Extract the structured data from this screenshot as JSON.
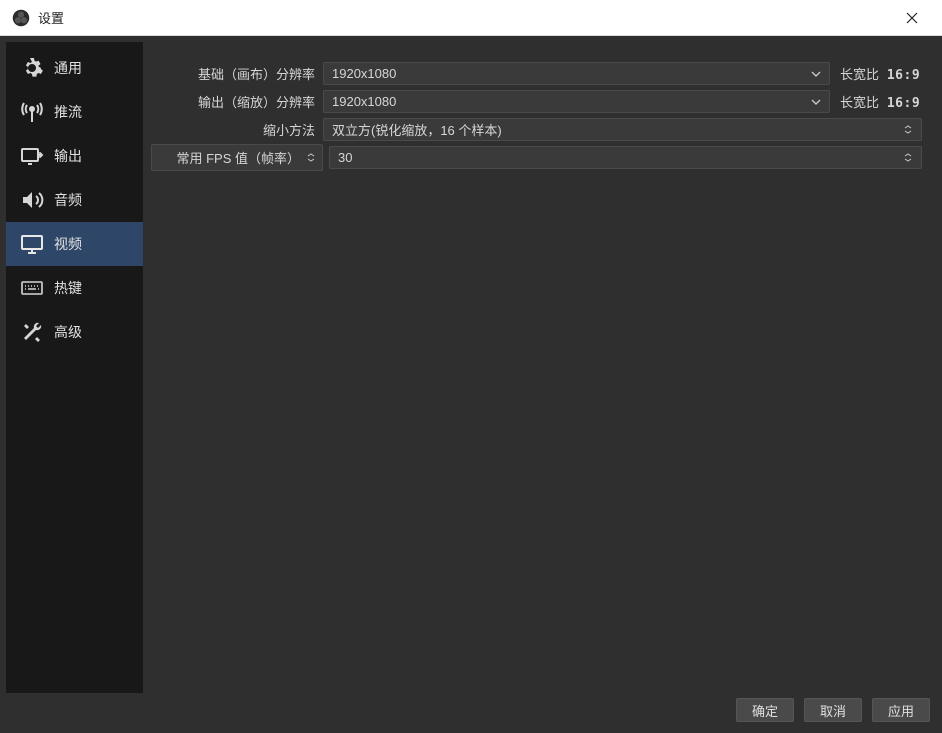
{
  "window": {
    "title": "设置"
  },
  "sidebar": {
    "items": [
      {
        "label": "通用",
        "icon": "gear"
      },
      {
        "label": "推流",
        "icon": "antenna"
      },
      {
        "label": "输出",
        "icon": "output"
      },
      {
        "label": "音频",
        "icon": "audio"
      },
      {
        "label": "视频",
        "icon": "monitor",
        "active": true
      },
      {
        "label": "热键",
        "icon": "keyboard"
      },
      {
        "label": "高级",
        "icon": "tools"
      }
    ]
  },
  "video": {
    "base_label": "基础（画布）分辨率",
    "base_value": "1920x1080",
    "base_aspect_label": "长宽比",
    "base_aspect": "16:9",
    "output_label": "输出（缩放）分辨率",
    "output_value": "1920x1080",
    "output_aspect_label": "长宽比",
    "output_aspect": "16:9",
    "scale_label": "缩小方法",
    "scale_value": "双立方(锐化缩放，16 个样本)",
    "fps_label": "常用 FPS 值（帧率）",
    "fps_value": "30"
  },
  "footer": {
    "ok": "确定",
    "cancel": "取消",
    "apply": "应用"
  }
}
